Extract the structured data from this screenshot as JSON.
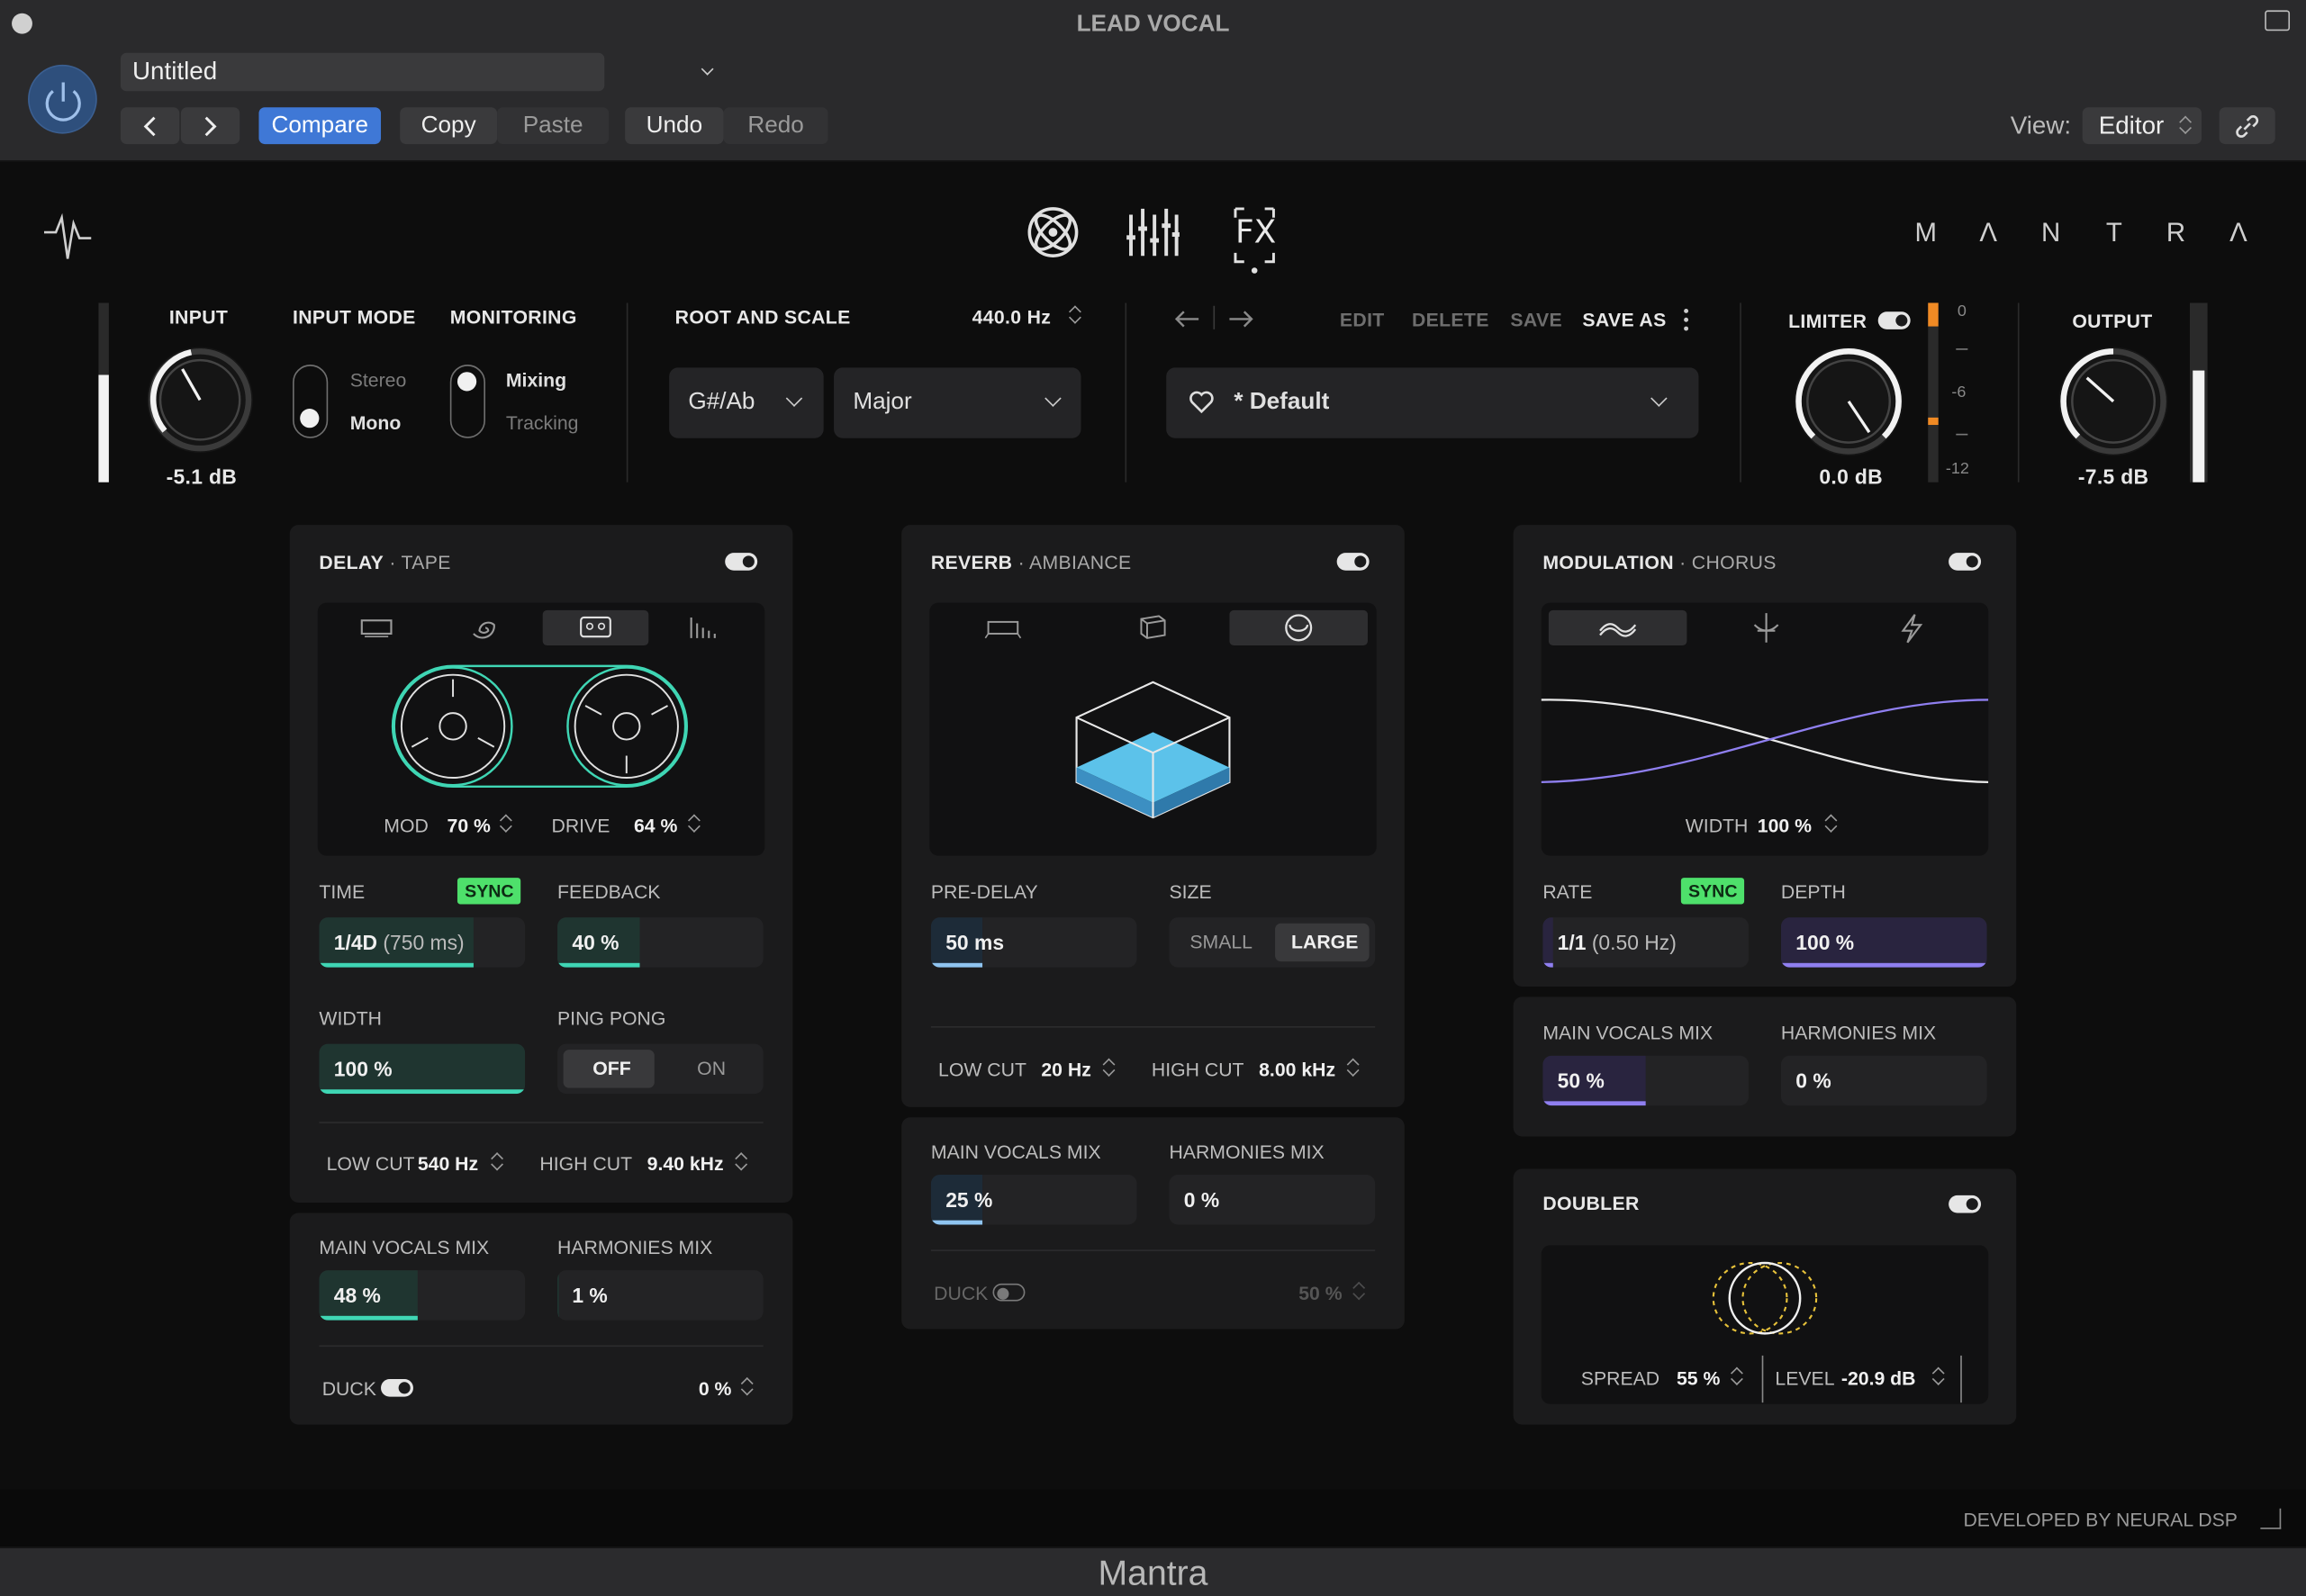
{
  "window": {
    "title": "LEAD VOCAL",
    "app_name": "Mantra",
    "developer": "DEVELOPED BY NEURAL DSP"
  },
  "host": {
    "preset_name": "Untitled",
    "compare": "Compare",
    "copy": "Copy",
    "paste": "Paste",
    "undo": "Undo",
    "redo": "Redo",
    "view_label": "View:",
    "view_value": "Editor"
  },
  "brand": {
    "logo_letters": [
      "M",
      "Λ",
      "N",
      "T",
      "R",
      "Λ"
    ]
  },
  "nav": {
    "tabs": [
      "tuner-icon",
      "mixer-icon",
      "fx-icon"
    ],
    "fx_label": "FX"
  },
  "io": {
    "input_label": "INPUT",
    "input_value": "-5.1 dB",
    "input_level": 0.6,
    "input_mode_label": "INPUT MODE",
    "input_mode_options": [
      "Stereo",
      "Mono"
    ],
    "input_mode_selected": "Mono",
    "monitoring_label": "MONITORING",
    "monitoring_options": [
      "Mixing",
      "Tracking"
    ],
    "monitoring_selected": "Mixing",
    "limiter_label": "LIMITER",
    "limiter_value": "0.0 dB",
    "limiter_on": true,
    "limiter_scale": [
      "0",
      "-6",
      "-12"
    ],
    "output_label": "OUTPUT",
    "output_value": "-7.5 dB",
    "output_level": 0.62
  },
  "root_scale": {
    "label": "ROOT AND SCALE",
    "tuning": "440.0 Hz",
    "root": "G#/Ab",
    "scale": "Major"
  },
  "preset": {
    "edit": "EDIT",
    "delete": "DELETE",
    "save": "SAVE",
    "save_as": "SAVE AS",
    "name": "* Default"
  },
  "delay": {
    "title": "DELAY",
    "type": "TAPE",
    "enabled": true,
    "mod_label": "MOD",
    "mod_value": "70 %",
    "drive_label": "DRIVE",
    "drive_value": "64 %",
    "time_label": "TIME",
    "sync_label": "SYNC",
    "time_value": "1/4D",
    "time_ms": "(750 ms)",
    "time_fill": 0.75,
    "feedback_label": "FEEDBACK",
    "feedback_value": "40 %",
    "feedback_fill": 0.4,
    "width_label": "WIDTH",
    "width_value": "100 %",
    "width_fill": 1.0,
    "pingpong_label": "PING PONG",
    "pingpong_off": "OFF",
    "pingpong_on": "ON",
    "pingpong_selected": "OFF",
    "lowcut_label": "LOW CUT",
    "lowcut_value": "540 Hz",
    "highcut_label": "HIGH CUT",
    "highcut_value": "9.40 kHz",
    "main_mix_label": "MAIN VOCALS MIX",
    "main_mix_value": "48 %",
    "main_mix_fill": 0.48,
    "harm_mix_label": "HARMONIES MIX",
    "harm_mix_value": "1 %",
    "harm_mix_fill": 0.01,
    "duck_label": "DUCK",
    "duck_on": true,
    "duck_value": "0 %"
  },
  "reverb": {
    "title": "REVERB",
    "type": "AMBIANCE",
    "enabled": true,
    "predelay_label": "PRE-DELAY",
    "predelay_value": "50 ms",
    "predelay_fill": 0.25,
    "size_label": "SIZE",
    "size_small": "SMALL",
    "size_large": "LARGE",
    "size_selected": "LARGE",
    "lowcut_label": "LOW CUT",
    "lowcut_value": "20 Hz",
    "highcut_label": "HIGH CUT",
    "highcut_value": "8.00 kHz",
    "main_mix_label": "MAIN VOCALS MIX",
    "main_mix_value": "25 %",
    "main_mix_fill": 0.25,
    "harm_mix_label": "HARMONIES MIX",
    "harm_mix_value": "0 %",
    "harm_mix_fill": 0,
    "duck_label": "DUCK",
    "duck_on": false,
    "duck_value": "50 %"
  },
  "modulation": {
    "title": "MODULATION",
    "type": "CHORUS",
    "enabled": true,
    "width_label": "WIDTH",
    "width_value": "100 %",
    "rate_label": "RATE",
    "sync_label": "SYNC",
    "rate_value": "1/1",
    "rate_hz": "(0.50 Hz)",
    "rate_fill": 0.05,
    "depth_label": "DEPTH",
    "depth_value": "100 %",
    "depth_fill": 1.0,
    "main_mix_label": "MAIN VOCALS MIX",
    "main_mix_value": "50 %",
    "main_mix_fill": 0.5,
    "harm_mix_label": "HARMONIES MIX",
    "harm_mix_value": "0 %",
    "harm_mix_fill": 0
  },
  "doubler": {
    "title": "DOUBLER",
    "enabled": true,
    "spread_label": "SPREAD",
    "spread_value": "55 %",
    "level_label": "LEVEL",
    "level_value": "-20.9 dB"
  },
  "colors": {
    "teal": "#3fd6b4",
    "reverb_blue": "#8fc4f0",
    "violet": "#8f7ff0",
    "sync_green": "#4ee06b",
    "accent_blue": "#3f78d6"
  }
}
